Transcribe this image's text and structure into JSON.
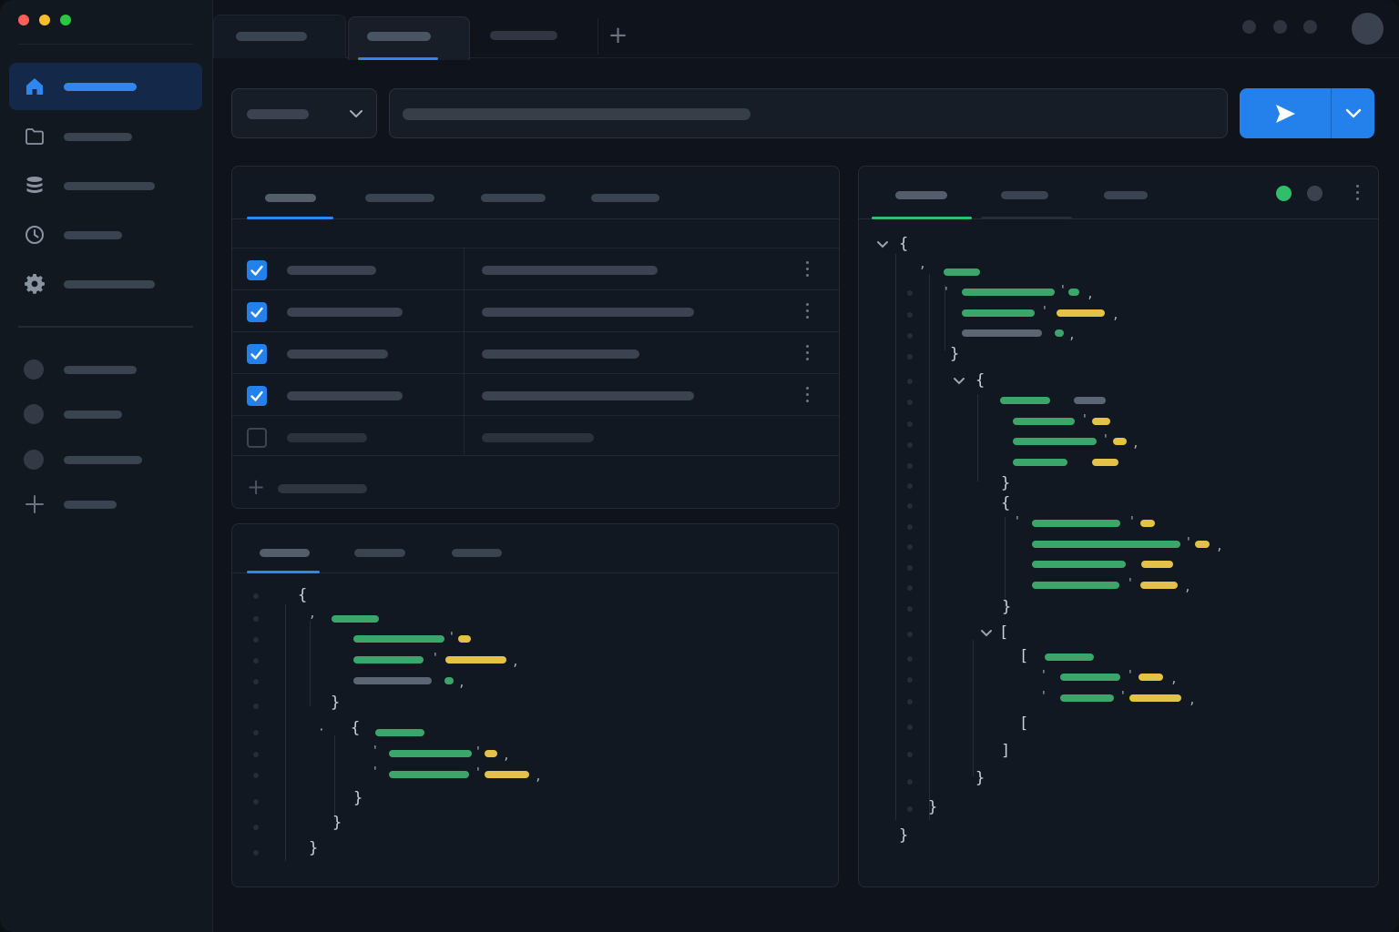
{
  "window": {
    "traffic_colors": [
      "#ff5f57",
      "#febc2e",
      "#28c840"
    ]
  },
  "sidebar": {
    "items": [
      {
        "label": "",
        "icon": "home-icon",
        "active": true
      },
      {
        "label": "",
        "icon": "folder-icon"
      },
      {
        "label": "",
        "icon": "database-icon"
      },
      {
        "label": "",
        "icon": "history-icon"
      },
      {
        "label": "",
        "icon": "settings-icon"
      }
    ],
    "collections": [
      {
        "label": "",
        "icon": "avatar-dot"
      },
      {
        "label": "",
        "icon": "avatar-dot"
      },
      {
        "label": "",
        "icon": "avatar-dot"
      }
    ],
    "add_label": "",
    "add_icon": "plus-icon"
  },
  "tabs": [
    {
      "label": ""
    },
    {
      "label": "",
      "active": true
    },
    {
      "label": ""
    }
  ],
  "tab_add_glyph": "+",
  "request": {
    "method": "",
    "url": "",
    "send_icon": "send-icon",
    "accent": "#2481ec"
  },
  "params_panel": {
    "tabs": [
      {
        "label": "",
        "active": true
      },
      {
        "label": ""
      },
      {
        "label": ""
      },
      {
        "label": ""
      }
    ],
    "rows": [
      {
        "checked": true,
        "key": "",
        "value": ""
      },
      {
        "checked": true,
        "key": "",
        "value": ""
      },
      {
        "checked": true,
        "key": "",
        "value": ""
      },
      {
        "checked": true,
        "key": "",
        "value": ""
      },
      {
        "checked": false,
        "key": "",
        "value": ""
      }
    ],
    "add_row_glyph": "+",
    "add_row_label": ""
  },
  "body_panel": {
    "tabs": [
      {
        "label": "",
        "active": true
      },
      {
        "label": ""
      },
      {
        "label": ""
      }
    ]
  },
  "response_panel": {
    "tabs": [
      {
        "label": "",
        "active": true
      },
      {
        "label": ""
      },
      {
        "label": ""
      }
    ],
    "status_colors": {
      "ok": "#2fbf6b",
      "idle": "#3a424e"
    }
  },
  "colors": {
    "key_token": "#3ca66a",
    "string_token": "#e3c247",
    "muted_token": "#5b6573"
  }
}
